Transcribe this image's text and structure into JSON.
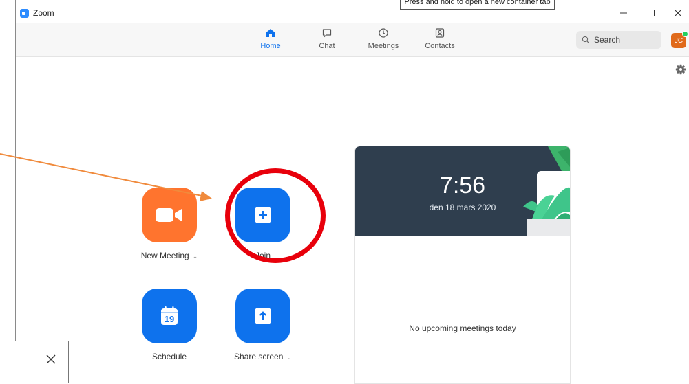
{
  "window": {
    "title": "Zoom",
    "tooltip": "Press and hold to open a new container tab"
  },
  "nav": [
    {
      "label": "Home",
      "icon": "home-icon",
      "active": true
    },
    {
      "label": "Chat",
      "icon": "chat-icon",
      "active": false
    },
    {
      "label": "Meetings",
      "icon": "clock-icon",
      "active": false
    },
    {
      "label": "Contacts",
      "icon": "contacts-icon",
      "active": false
    }
  ],
  "search": {
    "placeholder": "Search"
  },
  "user": {
    "initials": "JC"
  },
  "actions": {
    "new_meeting": "New Meeting",
    "join": "Join",
    "schedule": "Schedule",
    "schedule_day": "19",
    "share_screen": "Share screen"
  },
  "clock": {
    "time": "7:56",
    "date": "den 18 mars 2020"
  },
  "meetings": {
    "empty_text": "No upcoming meetings today"
  },
  "colors": {
    "accent": "#0e72ed",
    "new_meeting": "#ff742e",
    "highlight_ring": "#e8000b",
    "annotation_arrow": "#f08a3c"
  }
}
